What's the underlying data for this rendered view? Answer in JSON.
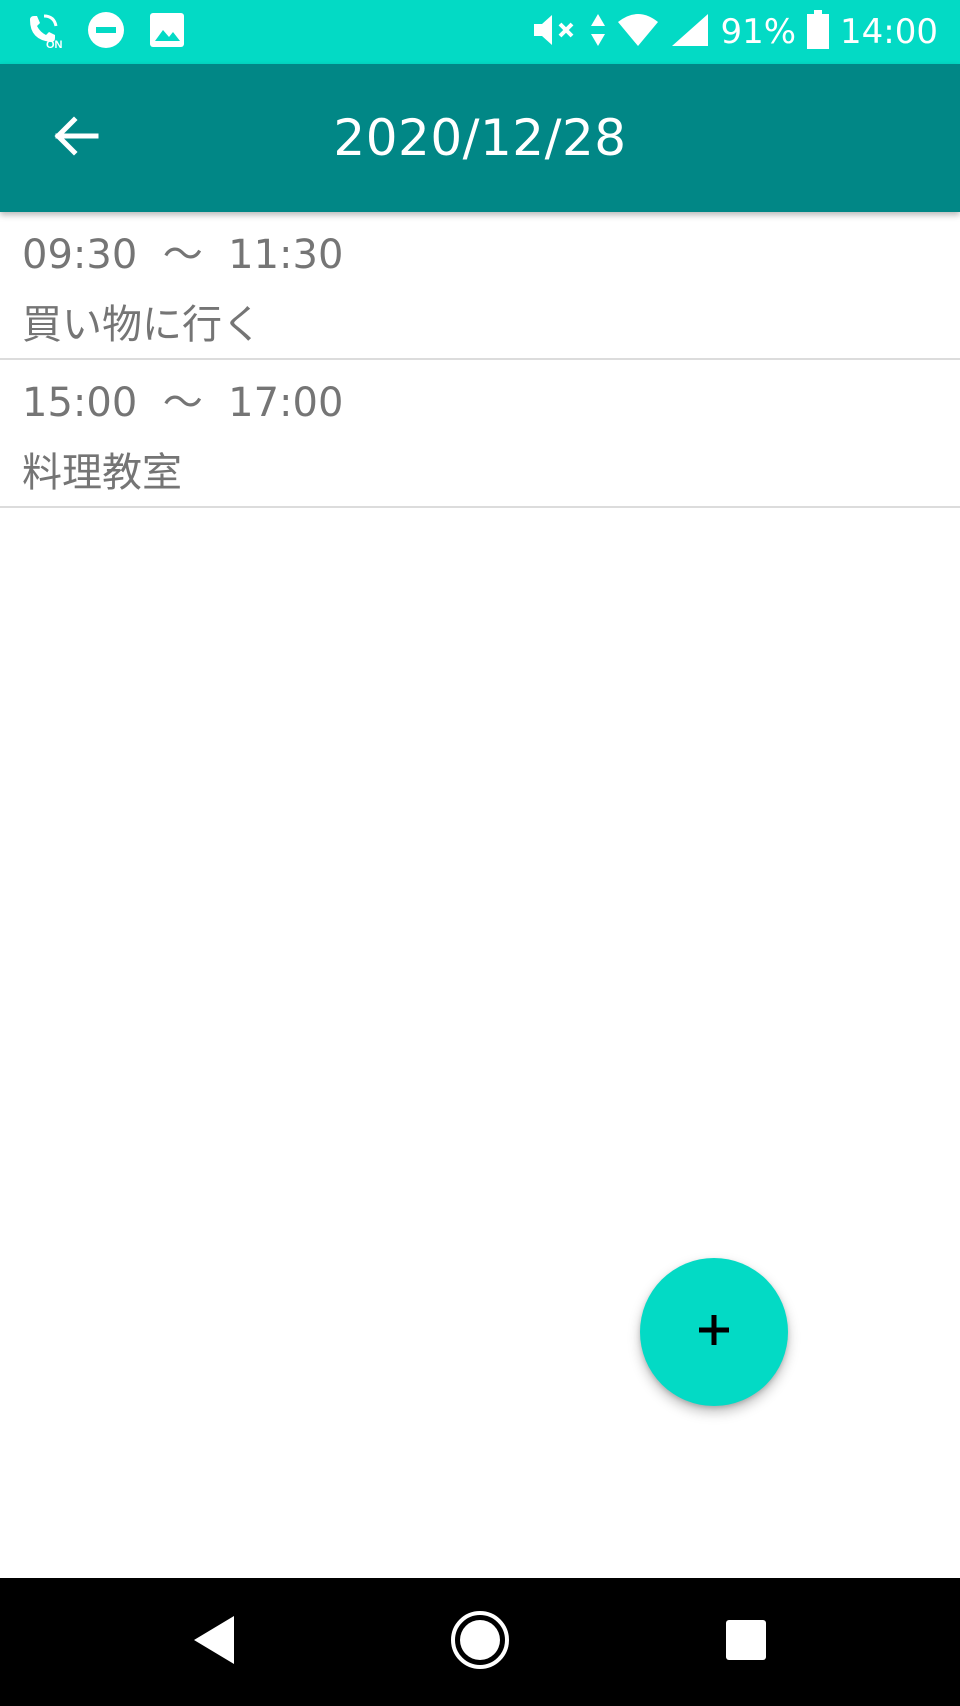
{
  "status_bar": {
    "left_icons": [
      "volte-on-icon",
      "do-not-disturb-icon",
      "image-icon"
    ],
    "right_icons": [
      "mute-icon",
      "data-arrows-icon",
      "wifi-icon",
      "signal-icon",
      "battery-icon"
    ],
    "battery_percent": "91%",
    "time": "14:00"
  },
  "app_bar": {
    "title": "2020/12/28",
    "back_icon": "arrow-back-icon"
  },
  "schedules": [
    {
      "time": "09:30  〜  11:30",
      "title": "買い物に行く"
    },
    {
      "time": "15:00  〜  17:00",
      "title": "料理教室"
    }
  ],
  "fab": {
    "icon": "plus-icon"
  },
  "nav_bar": {
    "back": "nav-back-icon",
    "home": "nav-home-icon",
    "recents": "nav-recents-icon"
  },
  "colors": {
    "status_bar": "#03dac5",
    "app_bar": "#018786",
    "fab": "#03dac5",
    "text_secondary": "#757575",
    "divider": "#dcdcdc"
  }
}
